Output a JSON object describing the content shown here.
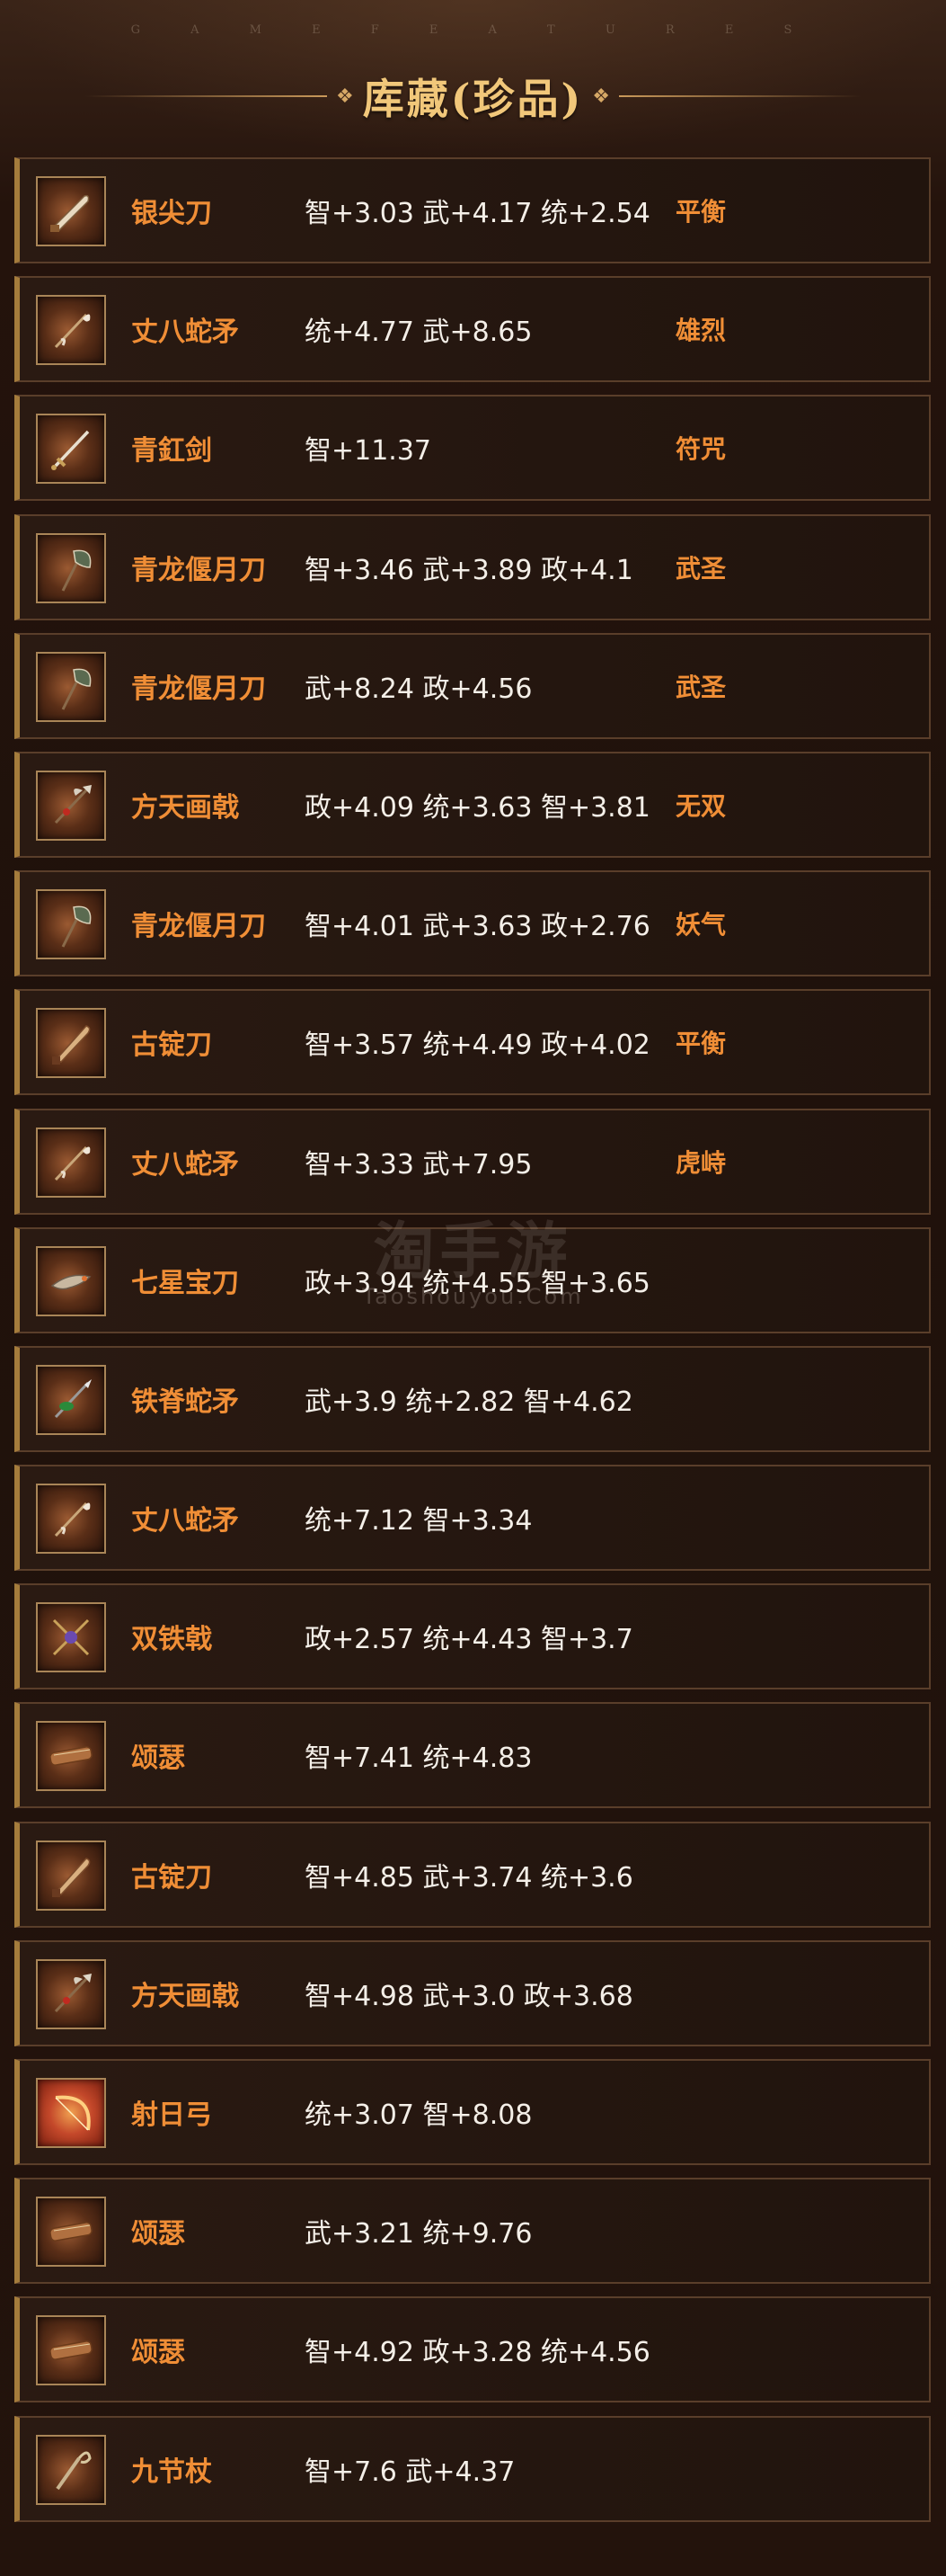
{
  "top_label": "G A M E   F E A T U R E S",
  "header": {
    "title": "库藏(珍品)",
    "ornament_left": "❖",
    "ornament_right": "❖"
  },
  "watermark": {
    "main": "淘手游",
    "sub": "Taoshouyou.Com"
  },
  "colors": {
    "name": "#f08e36",
    "stats": "#f4efe8",
    "accent": "#a57c3c",
    "title": "#f1c77a"
  },
  "items": [
    {
      "name": "银尖刀",
      "stats": "智+3.03 武+4.17 统+2.54",
      "trait": "平衡",
      "icon": "saber-icon"
    },
    {
      "name": "丈八蛇矛",
      "stats": "统+4.77 武+8.65",
      "trait": "雄烈",
      "icon": "spear-icon"
    },
    {
      "name": "青釭剑",
      "stats": "智+11.37",
      "trait": "符咒",
      "icon": "sword-icon"
    },
    {
      "name": "青龙偃月刀",
      "stats": "智+3.46 武+3.89 政+4.1",
      "trait": "武圣",
      "icon": "glaive-icon"
    },
    {
      "name": "青龙偃月刀",
      "stats": "武+8.24 政+4.56",
      "trait": "武圣",
      "icon": "glaive-icon"
    },
    {
      "name": "方天画戟",
      "stats": "政+4.09 统+3.63 智+3.81",
      "trait": "无双",
      "icon": "halberd-icon"
    },
    {
      "name": "青龙偃月刀",
      "stats": "智+4.01 武+3.63 政+2.76",
      "trait": "妖气",
      "icon": "glaive-icon"
    },
    {
      "name": "古锭刀",
      "stats": "智+3.57 统+4.49 政+4.02",
      "trait": "平衡",
      "icon": "blade-icon"
    },
    {
      "name": "丈八蛇矛",
      "stats": "智+3.33 武+7.95",
      "trait": "虎峙",
      "icon": "spear-icon"
    },
    {
      "name": "七星宝刀",
      "stats": "政+3.94 统+4.55 智+3.65",
      "trait": "",
      "icon": "dragon-blade-icon"
    },
    {
      "name": "铁脊蛇矛",
      "stats": "武+3.9 统+2.82 智+4.62",
      "trait": "",
      "icon": "serpent-spear-icon"
    },
    {
      "name": "丈八蛇矛",
      "stats": "统+7.12 智+3.34",
      "trait": "",
      "icon": "spear-icon"
    },
    {
      "name": "双铁戟",
      "stats": "政+2.57 统+4.43 智+3.7",
      "trait": "",
      "icon": "twin-halberd-icon"
    },
    {
      "name": "颂瑟",
      "stats": "智+7.41 统+4.83",
      "trait": "",
      "icon": "zither-icon"
    },
    {
      "name": "古锭刀",
      "stats": "智+4.85 武+3.74 统+3.6",
      "trait": "",
      "icon": "blade-icon"
    },
    {
      "name": "方天画戟",
      "stats": "智+4.98 武+3.0 政+3.68",
      "trait": "",
      "icon": "halberd-icon"
    },
    {
      "name": "射日弓",
      "stats": "统+3.07 智+8.08",
      "trait": "",
      "icon": "bow-icon"
    },
    {
      "name": "颂瑟",
      "stats": "武+3.21 统+9.76",
      "trait": "",
      "icon": "zither-icon"
    },
    {
      "name": "颂瑟",
      "stats": "智+4.92 政+3.28 统+4.56",
      "trait": "",
      "icon": "zither-icon"
    },
    {
      "name": "九节杖",
      "stats": "智+7.6 武+4.37",
      "trait": "",
      "icon": "staff-icon"
    }
  ]
}
